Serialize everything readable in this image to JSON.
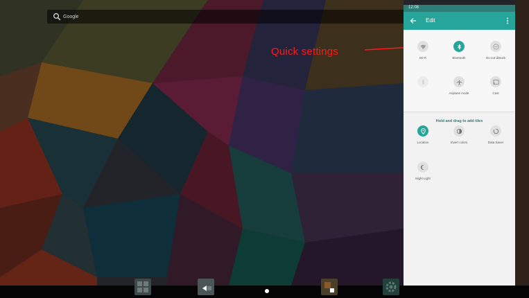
{
  "search": {
    "placeholder": "Google"
  },
  "annotation": {
    "label": "Quick settings",
    "color": "#ff1a1a"
  },
  "quick_settings": {
    "clock": "12:08",
    "toolbar_title": "Edit",
    "accent_color": "#26a69a",
    "active_tiles": [
      {
        "name": "wifi",
        "label": "Wi-Fi",
        "icon": "wifi-icon",
        "state": "off"
      },
      {
        "name": "bluetooth",
        "label": "Bluetooth",
        "icon": "bluetooth-icon",
        "state": "on"
      },
      {
        "name": "do-not-disturb",
        "label": "Do not disturb",
        "icon": "do-not-disturb-icon",
        "state": "off"
      },
      {
        "name": "flashlight",
        "label": "",
        "icon": "flashlight-icon",
        "state": "faded"
      },
      {
        "name": "airplane-mode",
        "label": "Airplane mode",
        "icon": "airplane-icon",
        "state": "off"
      },
      {
        "name": "cast",
        "label": "Cast",
        "icon": "cast-icon",
        "state": "off"
      }
    ],
    "hint": "Hold and drag to add tiles",
    "available_tiles": [
      {
        "name": "location",
        "label": "Location",
        "icon": "location-pin-icon",
        "state": "on"
      },
      {
        "name": "invert-colors",
        "label": "Invert colors",
        "icon": "invert-colors-icon",
        "state": "off"
      },
      {
        "name": "data-saver",
        "label": "Data Saver",
        "icon": "data-saver-icon",
        "state": "off"
      },
      {
        "name": "night-light",
        "label": "Night Light",
        "icon": "night-light-icon",
        "state": "off"
      }
    ]
  }
}
